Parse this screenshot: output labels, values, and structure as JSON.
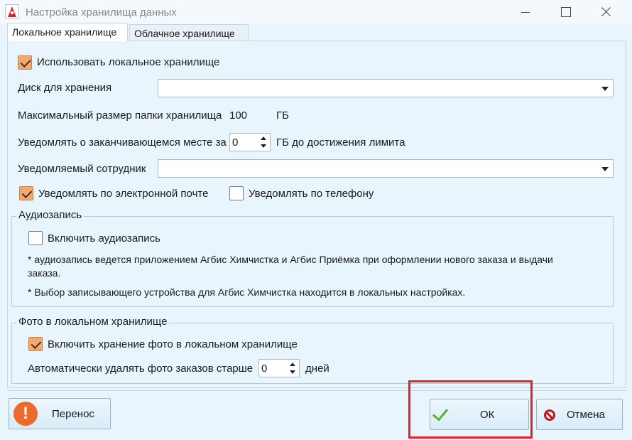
{
  "window": {
    "title": "Настройка хранилища данных"
  },
  "tabs": {
    "local": "Локальное хранилище",
    "cloud": "Облачное хранилище"
  },
  "local": {
    "use_local_label": "Использовать локальное хранилище",
    "use_local_checked": true,
    "disk_label": "Диск для хранения",
    "disk_value": "",
    "max_size_label": "Максимальный размер папки хранилища",
    "max_size_value": "100",
    "max_size_unit": "ГБ",
    "notify_label": "Уведомлять о заканчивающемся месте за",
    "notify_value": "0",
    "notify_suffix": "ГБ до достижения лимита",
    "employee_label": "Уведомляемый сотрудник",
    "employee_value": "",
    "notify_email_label": "Уведомлять по электронной почте",
    "notify_email_checked": true,
    "notify_phone_label": "Уведомлять по телефону",
    "notify_phone_checked": false
  },
  "audio": {
    "group_title": "Аудиозапись",
    "enable_label": "Включить аудиозапись",
    "enable_checked": false,
    "note1_line1": "* аудиозапись ведется приложением Агбис Химчистка и Агбис Приёмка при оформлении нового заказа и выдачи",
    "note1_line2": "заказа.",
    "note2": "* Выбор записывающего устройства для Агбис Химчистка находится в локальных настройках."
  },
  "photo": {
    "group_title": "Фото в локальном хранилище",
    "enable_label": "Включить хранение фото в локальном хранилище",
    "enable_checked": true,
    "autodelete_label": "Автоматически удалять фото заказов старше",
    "autodelete_value": "0",
    "autodelete_unit": "дней"
  },
  "buttons": {
    "transfer": "Перенос",
    "ok": "ОК",
    "cancel": "Отмена"
  },
  "icons": {
    "app": "agbis-logo-icon",
    "transfer": "exclamation-icon",
    "ok": "checkmark-icon",
    "cancel": "no-entry-icon"
  },
  "colors": {
    "checkbox_checked": "#f6a86a",
    "highlight": "#e0222a",
    "background": "#e9f5fd"
  }
}
